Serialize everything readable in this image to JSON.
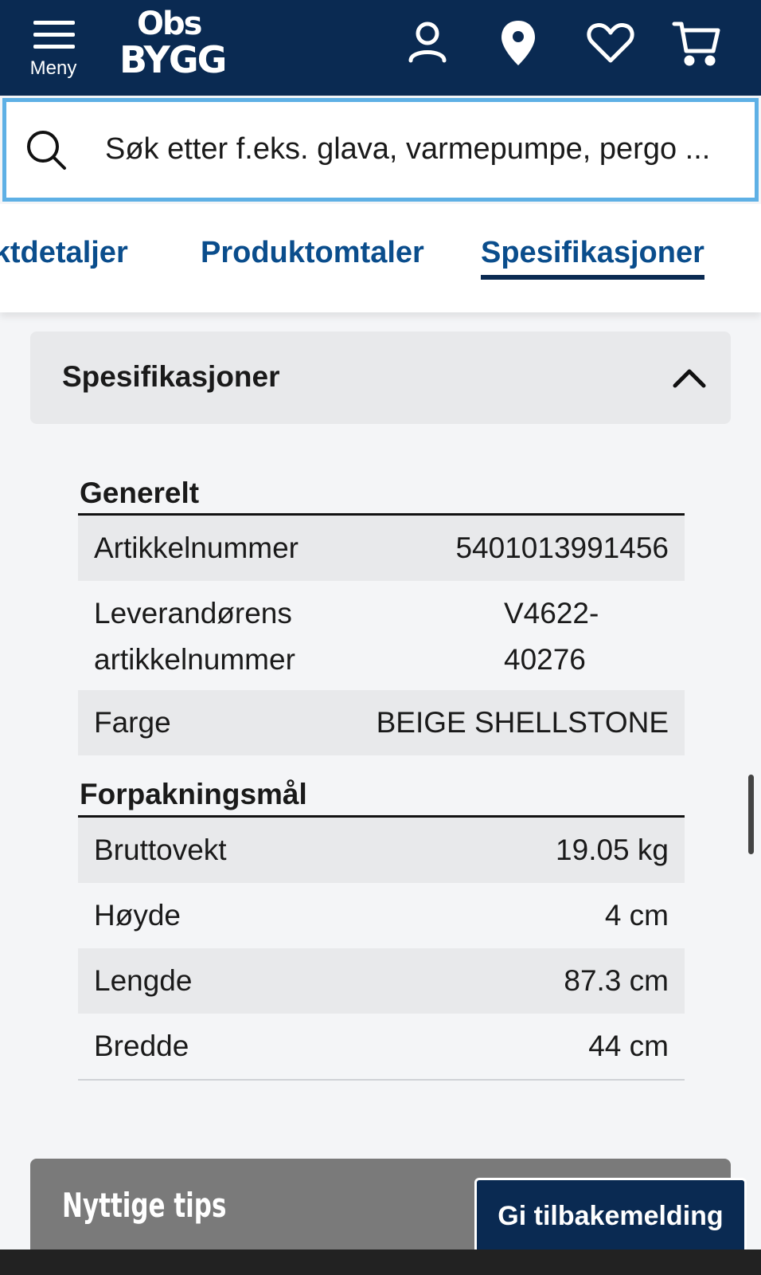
{
  "header": {
    "menu_label": "Meny",
    "logo_line1": "Obs",
    "logo_line2": "BYGG",
    "icons": [
      "user-icon",
      "location-icon",
      "heart-icon",
      "cart-icon"
    ]
  },
  "search": {
    "placeholder": "Søk etter f.eks. glava, varmepumpe, pergo ..."
  },
  "tabs": [
    {
      "label": "Produktdetaljer"
    },
    {
      "label": "Produktomtaler"
    },
    {
      "label": "Spesifikasjoner",
      "active": true
    }
  ],
  "accordion": {
    "title": "Spesifikasjoner",
    "expanded": true
  },
  "specs": {
    "general": {
      "title": "Generelt",
      "rows": [
        {
          "key": "Artikkelnummer",
          "value": "5401013991456"
        },
        {
          "key_line1": "Leverandørens",
          "key_line2": "artikkelnummer",
          "value_line1": "V4622-",
          "value_line2": "40276"
        },
        {
          "key": "Farge",
          "value": "BEIGE SHELLSTONE"
        }
      ]
    },
    "packaging": {
      "title": "Forpakningsmål",
      "rows": [
        {
          "key": "Bruttovekt",
          "value": "19.05 kg"
        },
        {
          "key": "Høyde",
          "value": "4 cm"
        },
        {
          "key": "Lengde",
          "value": "87.3 cm"
        },
        {
          "key": "Bredde",
          "value": "44 cm"
        }
      ]
    }
  },
  "tips": {
    "title": "Nyttige tips"
  },
  "feedback_button": "Gi tilbakemelding",
  "colors": {
    "header_bg": "#0a2a52",
    "search_border": "#5eb0e5",
    "tab_text": "#0a4d8c",
    "shaded_row": "#e8e9eb"
  }
}
